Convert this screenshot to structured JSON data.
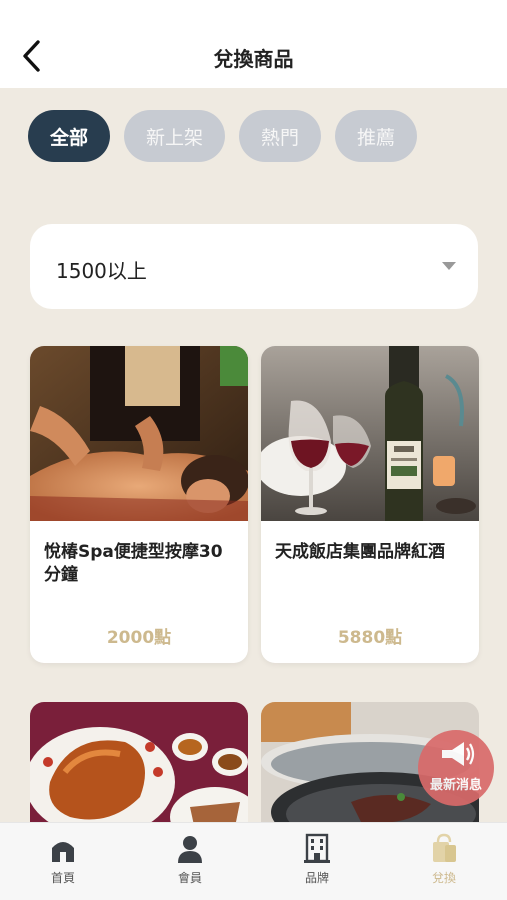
{
  "header": {
    "title": "兌換商品"
  },
  "tabs": [
    {
      "label": "全部",
      "active": true
    },
    {
      "label": "新上架",
      "active": false
    },
    {
      "label": "熱門",
      "active": false
    },
    {
      "label": "推薦",
      "active": false
    }
  ],
  "filter": {
    "selected": "1500以上"
  },
  "products": [
    {
      "name": "悅椿Spa便捷型按摩30分鐘",
      "points": "2000點"
    },
    {
      "name": "天成飯店集團品牌紅酒",
      "points": "5880點"
    }
  ],
  "fab": {
    "label": "最新消息"
  },
  "bottom_nav": [
    {
      "label": "首頁",
      "icon": "home-icon"
    },
    {
      "label": "會員",
      "icon": "user-icon"
    },
    {
      "label": "品牌",
      "icon": "building-icon"
    },
    {
      "label": "兌換",
      "icon": "shopping-bag-icon",
      "active": true
    }
  ],
  "colors": {
    "accent": "#283d4f",
    "gold": "#cdb98e",
    "background": "#efeae1"
  }
}
